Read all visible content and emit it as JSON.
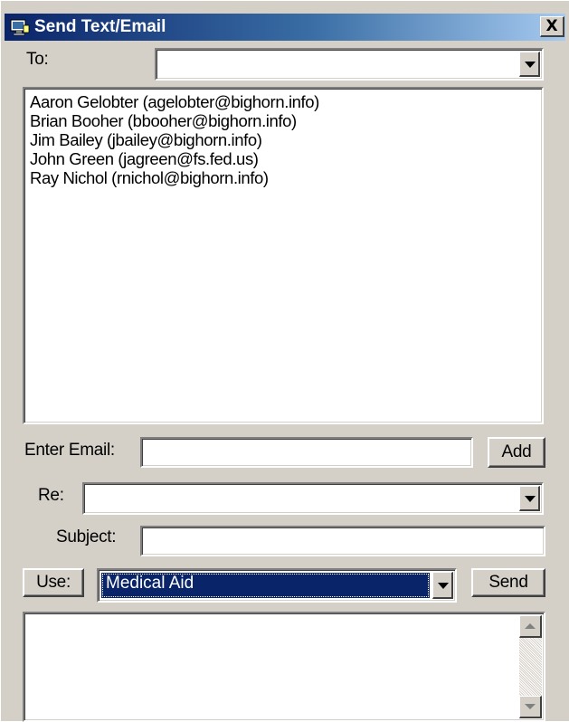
{
  "window": {
    "title": "Send Text/Email",
    "close_label": "X"
  },
  "to": {
    "label": "To:",
    "value": ""
  },
  "recipients": [
    "Aaron Gelobter (agelobter@bighorn.info)",
    "Brian Booher (bbooher@bighorn.info)",
    "Jim Bailey (jbailey@bighorn.info)",
    "John Green (jagreen@fs.fed.us)",
    "Ray Nichol (rnichol@bighorn.info)"
  ],
  "enter_email": {
    "label": "Enter Email:",
    "value": "",
    "add_label": "Add"
  },
  "re": {
    "label": "Re:",
    "value": ""
  },
  "subject": {
    "label": "Subject:",
    "value": ""
  },
  "use": {
    "button_label": "Use:",
    "selected": "Medical Aid",
    "send_label": "Send"
  },
  "message": {
    "value": ""
  },
  "icons": {
    "title_icon": "app-icon",
    "dropdown": "chevron-down-icon",
    "scroll_up": "scroll-up-icon",
    "scroll_down": "scroll-down-icon"
  },
  "colors": {
    "title_start": "#0a246a",
    "title_end": "#a6caf0",
    "face": "#d4d0c8",
    "selection": "#0a246a"
  }
}
